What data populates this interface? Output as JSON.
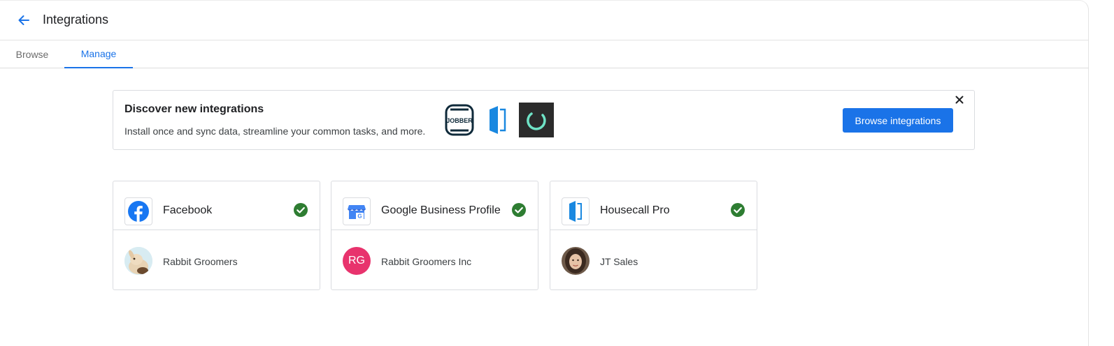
{
  "header": {
    "title": "Integrations"
  },
  "tabs": [
    {
      "label": "Browse",
      "active": false
    },
    {
      "label": "Manage",
      "active": true
    }
  ],
  "banner": {
    "title": "Discover new integrations",
    "subtitle": "Install once and sync data, streamline your common tasks, and more.",
    "logos": [
      "jobber-logo",
      "housecall-pro-logo",
      "ring-logo"
    ],
    "jobber_text": "JOBBER",
    "button_label": "Browse integrations"
  },
  "cards": [
    {
      "name": "Facebook",
      "icon": "facebook-icon",
      "connected": true,
      "account": "Rabbit Groomers",
      "avatar": "rabbit-photo"
    },
    {
      "name": "Google Business Profile",
      "icon": "google-business-icon",
      "connected": true,
      "account": "Rabbit Groomers Inc",
      "avatar_initials": "RG"
    },
    {
      "name": "Housecall Pro",
      "icon": "housecall-pro-icon",
      "connected": true,
      "account": "JT Sales",
      "avatar": "person-photo"
    }
  ],
  "colors": {
    "accent": "#1a73e8",
    "success": "#2e7d32",
    "avatar_rg": "#e8336d",
    "facebook": "#1877f2"
  }
}
